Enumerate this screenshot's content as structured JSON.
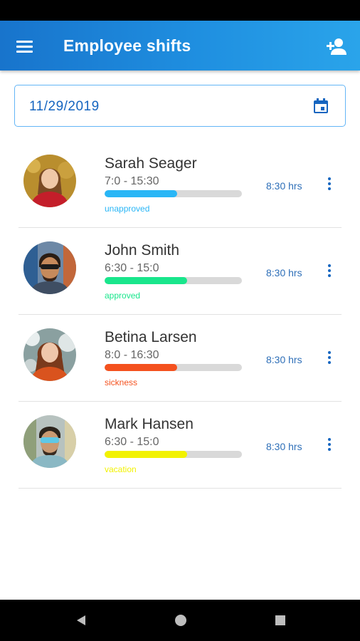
{
  "app_bar": {
    "title": "Employee shifts",
    "background": "#1f8fe0",
    "icons": {
      "menu": "menu-icon",
      "add_user": "add-person-icon"
    }
  },
  "date_picker": {
    "value": "11/29/2019",
    "icon": "calendar-icon"
  },
  "shifts": [
    {
      "name": "Sarah Seager",
      "time": "7:0 - 15:30",
      "hours": "8:30 hrs",
      "status": "unapproved",
      "status_color": "#29b6f6",
      "progress": 0.53
    },
    {
      "name": "John Smith",
      "time": "6:30 - 15:0",
      "hours": "8:30 hrs",
      "status": "approved",
      "status_color": "#19e68c",
      "progress": 0.6
    },
    {
      "name": "Betina Larsen",
      "time": "8:0 - 16:30",
      "hours": "8:30 hrs",
      "status": "sickness",
      "status_color": "#f4511e",
      "progress": 0.53
    },
    {
      "name": "Mark Hansen",
      "time": "6:30 - 15:0",
      "hours": "8:30 hrs",
      "status": "vacation",
      "status_color": "#f2f200",
      "progress": 0.6
    }
  ],
  "nav": {
    "back": "back-icon",
    "home": "home-icon",
    "recents": "recents-icon"
  }
}
